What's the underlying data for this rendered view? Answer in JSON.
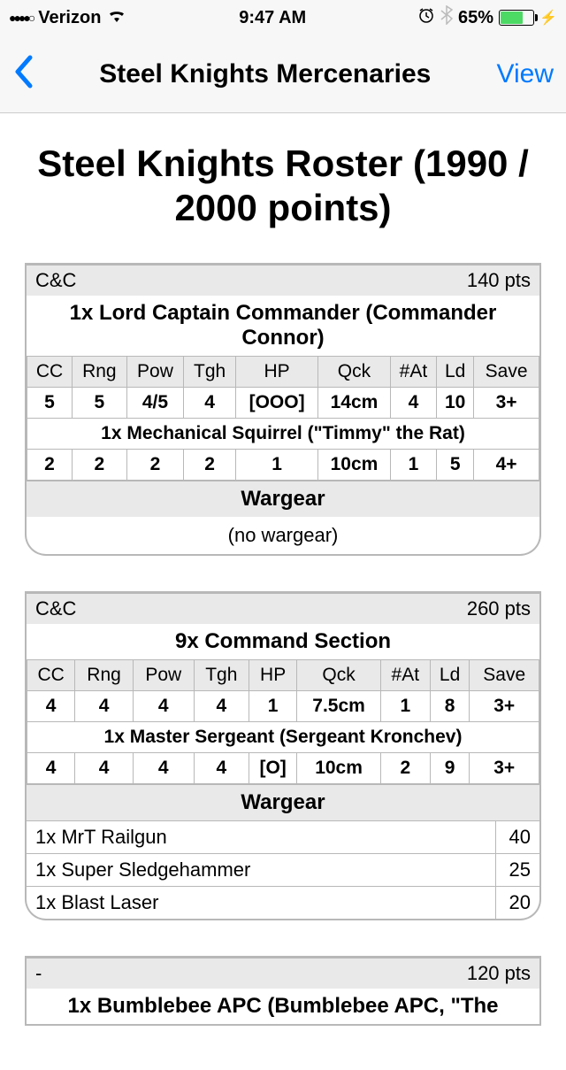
{
  "status": {
    "signal_dots": "●●●●○",
    "carrier": "Verizon",
    "time": "9:47 AM",
    "battery_pct": "65%"
  },
  "nav": {
    "title": "Steel Knights Mercenaries",
    "action": "View"
  },
  "page": {
    "title": "Steel Knights Roster (1990 / 2000 points)"
  },
  "stat_headers": [
    "CC",
    "Rng",
    "Pow",
    "Tgh",
    "HP",
    "Qck",
    "#At",
    "Ld",
    "Save"
  ],
  "wargear_label": "Wargear",
  "units": [
    {
      "category": "C&C",
      "points": "140 pts",
      "entries": [
        {
          "title": "1x Lord Captain Commander (Commander Connor)",
          "stats": [
            "5",
            "5",
            "4/5",
            "4",
            "[OOO]",
            "14cm",
            "4",
            "10",
            "3+"
          ]
        },
        {
          "title": "1x Mechanical Squirrel (\"Timmy\" the Rat)",
          "stats": [
            "2",
            "2",
            "2",
            "2",
            "1",
            "10cm",
            "1",
            "5",
            "4+"
          ]
        }
      ],
      "wargear_empty": "(no wargear)",
      "wargear": []
    },
    {
      "category": "C&C",
      "points": "260 pts",
      "entries": [
        {
          "title": "9x Command Section",
          "stats": [
            "4",
            "4",
            "4",
            "4",
            "1",
            "7.5cm",
            "1",
            "8",
            "3+"
          ]
        },
        {
          "title": "1x Master Sergeant (Sergeant Kronchev)",
          "stats": [
            "4",
            "4",
            "4",
            "4",
            "[O]",
            "10cm",
            "2",
            "9",
            "3+"
          ]
        }
      ],
      "wargear": [
        {
          "name": "1x MrT Railgun",
          "cost": "40"
        },
        {
          "name": "1x Super Sledgehammer",
          "cost": "25"
        },
        {
          "name": "1x Blast Laser",
          "cost": "20"
        }
      ]
    },
    {
      "category": "-",
      "points": "120 pts",
      "entries": [
        {
          "title": "1x Bumblebee APC (Bumblebee APC, \"The"
        }
      ]
    }
  ]
}
